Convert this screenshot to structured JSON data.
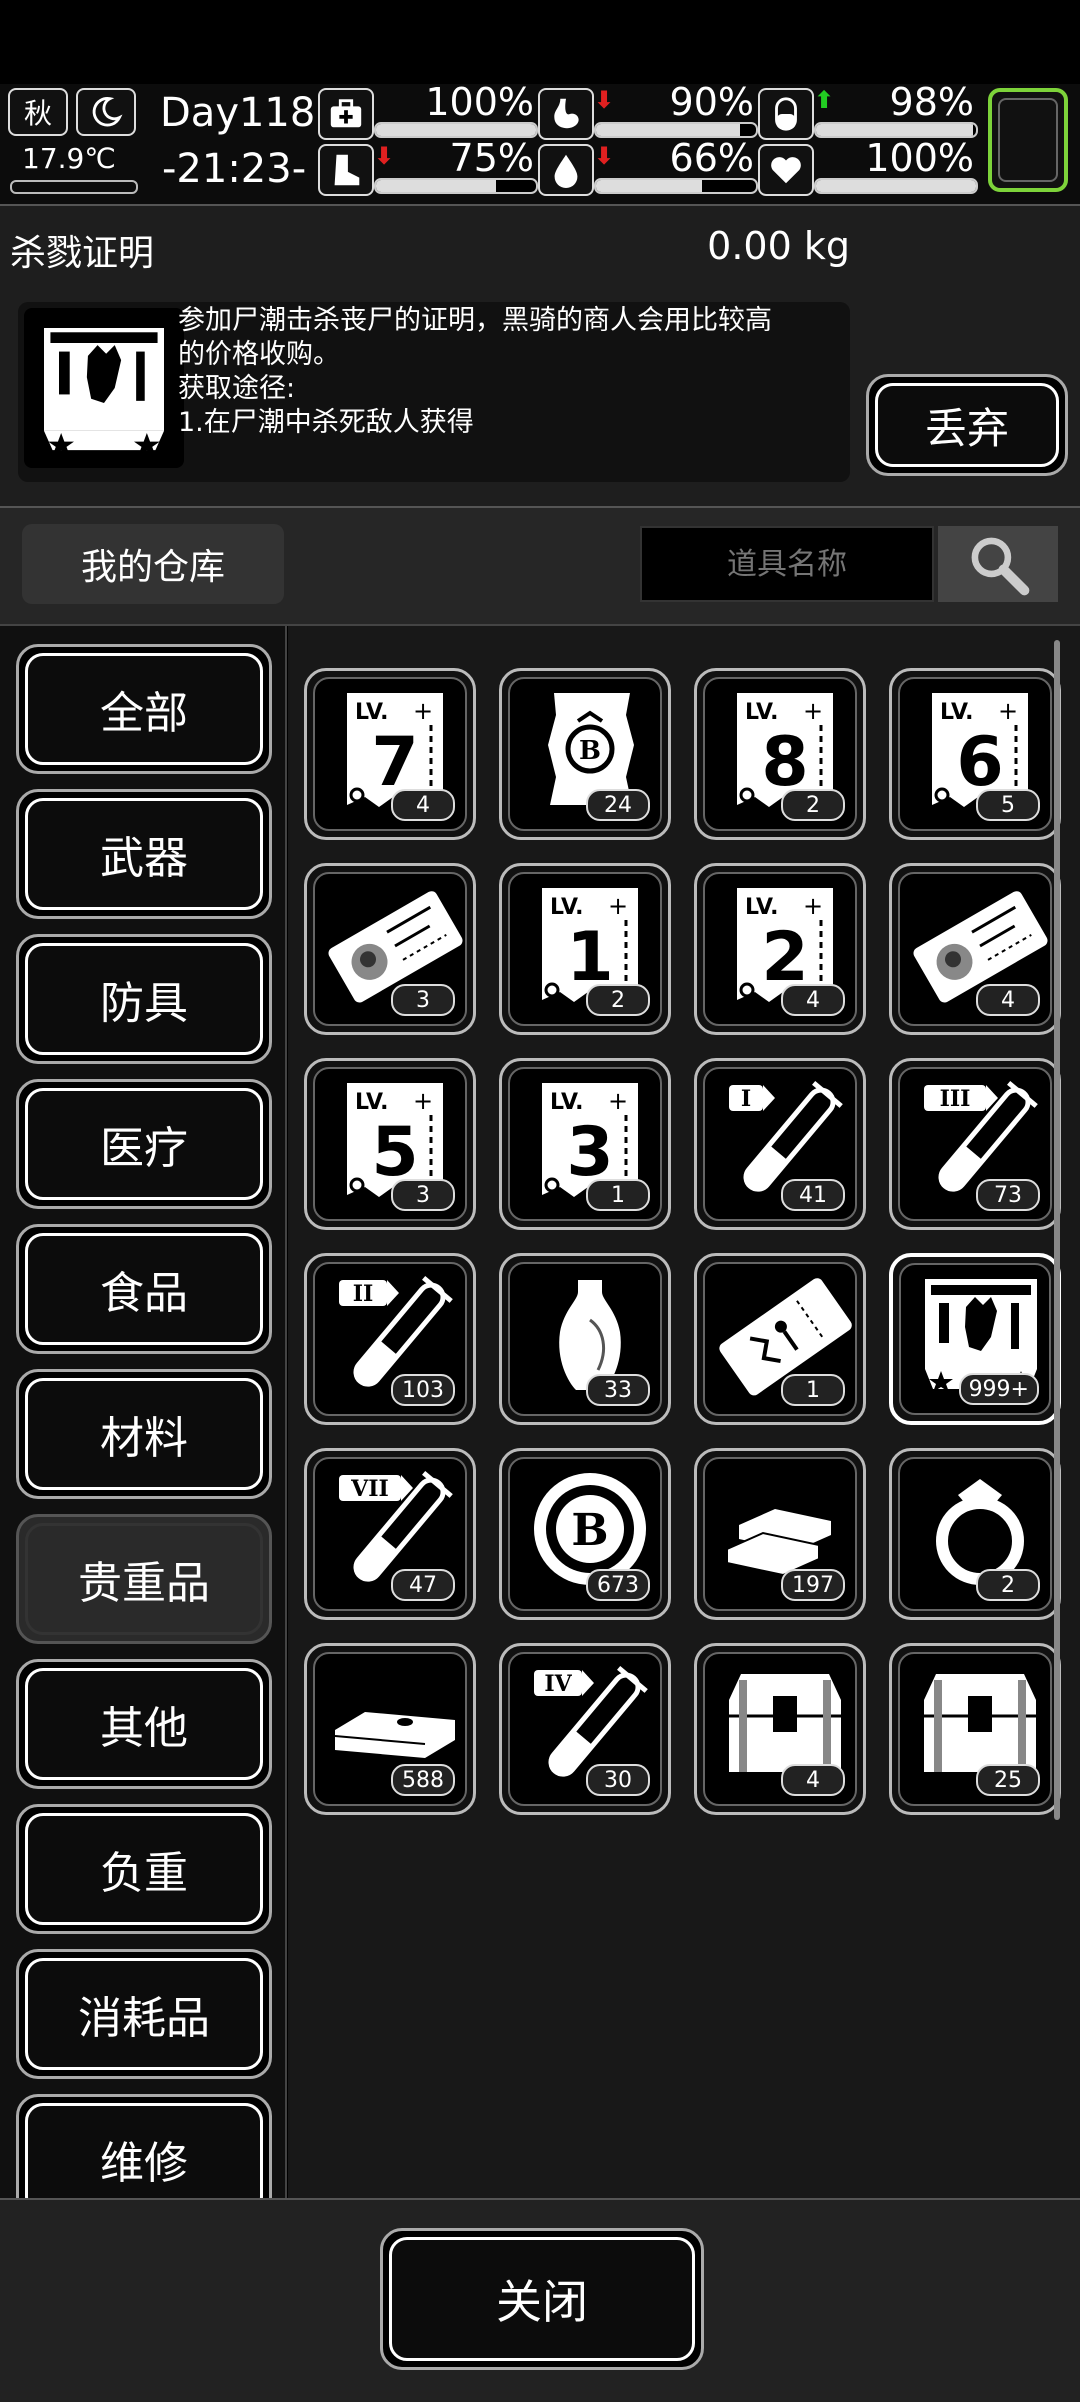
{
  "status": {
    "season": "秋",
    "temperature": "17.9℃",
    "day": "Day118",
    "time": "-21:23-",
    "bars": [
      {
        "icon": "medkit-icon",
        "pct": "100%",
        "value": 1.0,
        "arrow": ""
      },
      {
        "icon": "stomach-icon",
        "pct": "90%",
        "value": 0.9,
        "arrow": "down"
      },
      {
        "icon": "pill-icon",
        "pct": "98%",
        "value": 0.98,
        "arrow": "up"
      },
      {
        "icon": "boot-icon",
        "pct": "75%",
        "value": 0.75,
        "arrow": "down"
      },
      {
        "icon": "water-drop-icon",
        "pct": "66%",
        "value": 0.66,
        "arrow": "down"
      },
      {
        "icon": "heart-icon",
        "pct": "100%",
        "value": 1.0,
        "arrow": ""
      }
    ],
    "colors": {
      "down_arrow": "#e02020",
      "up_arrow": "#22cc22",
      "highlight": "#7dd33a"
    }
  },
  "item_detail": {
    "name": "杀戮证明",
    "weight": "0.00 kg",
    "desc_line1": "参加尸潮击杀丧尸的证明，黑骑的商人会用比较高",
    "desc_line2": "的价格收购。",
    "desc_line3": "获取途径:",
    "desc_line4": "1.在尸潮中杀死敌人获得",
    "discard_label": "丢弃"
  },
  "warehouse": {
    "title": "我的仓库",
    "search_placeholder": "道具名称"
  },
  "categories": [
    "全部",
    "武器",
    "防具",
    "医疗",
    "食品",
    "材料",
    "贵重品",
    "其他",
    "负重",
    "消耗品",
    "维修"
  ],
  "selected_category": "贵重品",
  "items": [
    {
      "type": "lv-scroll",
      "label": "7",
      "count": "4"
    },
    {
      "type": "b-scroll",
      "label": "B",
      "count": "24"
    },
    {
      "type": "lv-scroll",
      "label": "8",
      "count": "2"
    },
    {
      "type": "lv-scroll",
      "label": "6",
      "count": "5"
    },
    {
      "type": "ticket-face",
      "label": "",
      "count": "3"
    },
    {
      "type": "lv-scroll",
      "label": "1",
      "count": "2"
    },
    {
      "type": "lv-scroll",
      "label": "2",
      "count": "4"
    },
    {
      "type": "ticket-face",
      "label": "",
      "count": "4"
    },
    {
      "type": "lv-scroll",
      "label": "5",
      "count": "3"
    },
    {
      "type": "lv-scroll",
      "label": "3",
      "count": "1"
    },
    {
      "type": "test-tube",
      "label": "I",
      "count": "41"
    },
    {
      "type": "test-tube",
      "label": "III",
      "count": "73"
    },
    {
      "type": "test-tube",
      "label": "II",
      "count": "103"
    },
    {
      "type": "vase",
      "label": "",
      "count": "33"
    },
    {
      "type": "ticket-figure",
      "label": "",
      "count": "1"
    },
    {
      "type": "kill-proof",
      "label": "",
      "count": "999+"
    },
    {
      "type": "test-tube",
      "label": "VII",
      "count": "47"
    },
    {
      "type": "coin",
      "label": "B",
      "count": "673"
    },
    {
      "type": "gold-bars",
      "label": "",
      "count": "197"
    },
    {
      "type": "ring",
      "label": "",
      "count": "2"
    },
    {
      "type": "cash",
      "label": "",
      "count": "588"
    },
    {
      "type": "test-tube",
      "label": "IV",
      "count": "30"
    },
    {
      "type": "chest",
      "label": "",
      "count": "4"
    },
    {
      "type": "chest",
      "label": "",
      "count": "25"
    }
  ],
  "close_label": "关闭"
}
